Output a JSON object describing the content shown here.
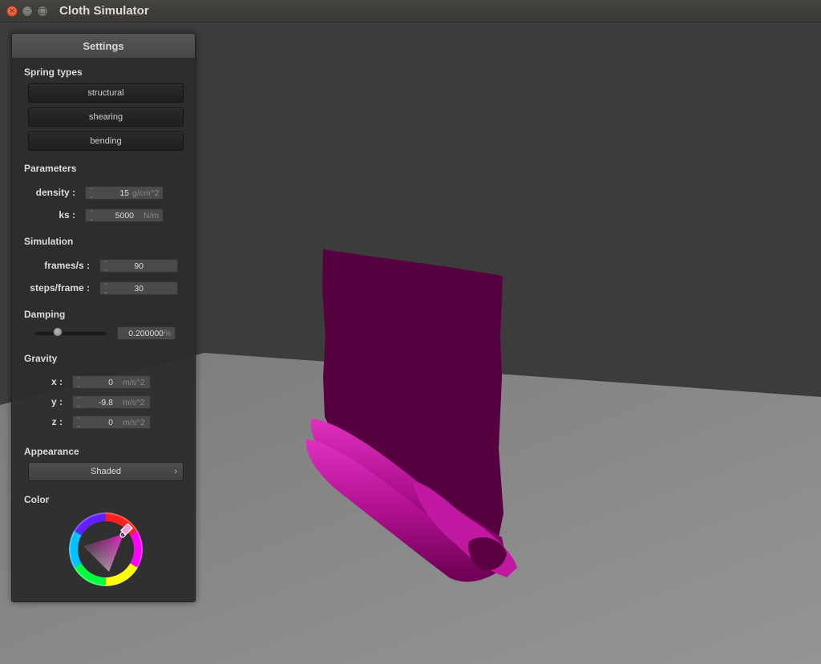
{
  "window": {
    "title": "Cloth Simulator",
    "close_glyph": "×",
    "minimize_glyph": "–",
    "maximize_glyph": "□"
  },
  "panel": {
    "title": "Settings",
    "spring_types": {
      "label": "Spring types",
      "buttons": [
        "structural",
        "shearing",
        "bending"
      ]
    },
    "parameters": {
      "label": "Parameters",
      "density": {
        "label": "density :",
        "value": "15",
        "unit": "g/cm^2"
      },
      "ks": {
        "label": "ks :",
        "value": "5000",
        "unit": "N/m"
      }
    },
    "simulation": {
      "label": "Simulation",
      "fps": {
        "label": "frames/s :",
        "value": "90"
      },
      "steps": {
        "label": "steps/frame :",
        "value": "30"
      }
    },
    "damping": {
      "label": "Damping",
      "value": "0.200000",
      "unit": "%",
      "slider_fraction": 0.2
    },
    "gravity": {
      "label": "Gravity",
      "x": {
        "label": "x :",
        "value": "0",
        "unit": "m/s^2"
      },
      "y": {
        "label": "y :",
        "value": "-9.8",
        "unit": "m/s^2"
      },
      "z": {
        "label": "z :",
        "value": "0",
        "unit": "m/s^2"
      }
    },
    "appearance": {
      "label": "Appearance",
      "selected": "Shaded",
      "chevron": "›"
    },
    "color": {
      "label": "Color",
      "selected_hex": "#e020c0"
    }
  },
  "scene": {
    "background_color": "#3c3c3c",
    "floor_color": "#8a8a8a",
    "cloth_color": "#5a0040",
    "cloth_highlight": "#d020a8"
  }
}
